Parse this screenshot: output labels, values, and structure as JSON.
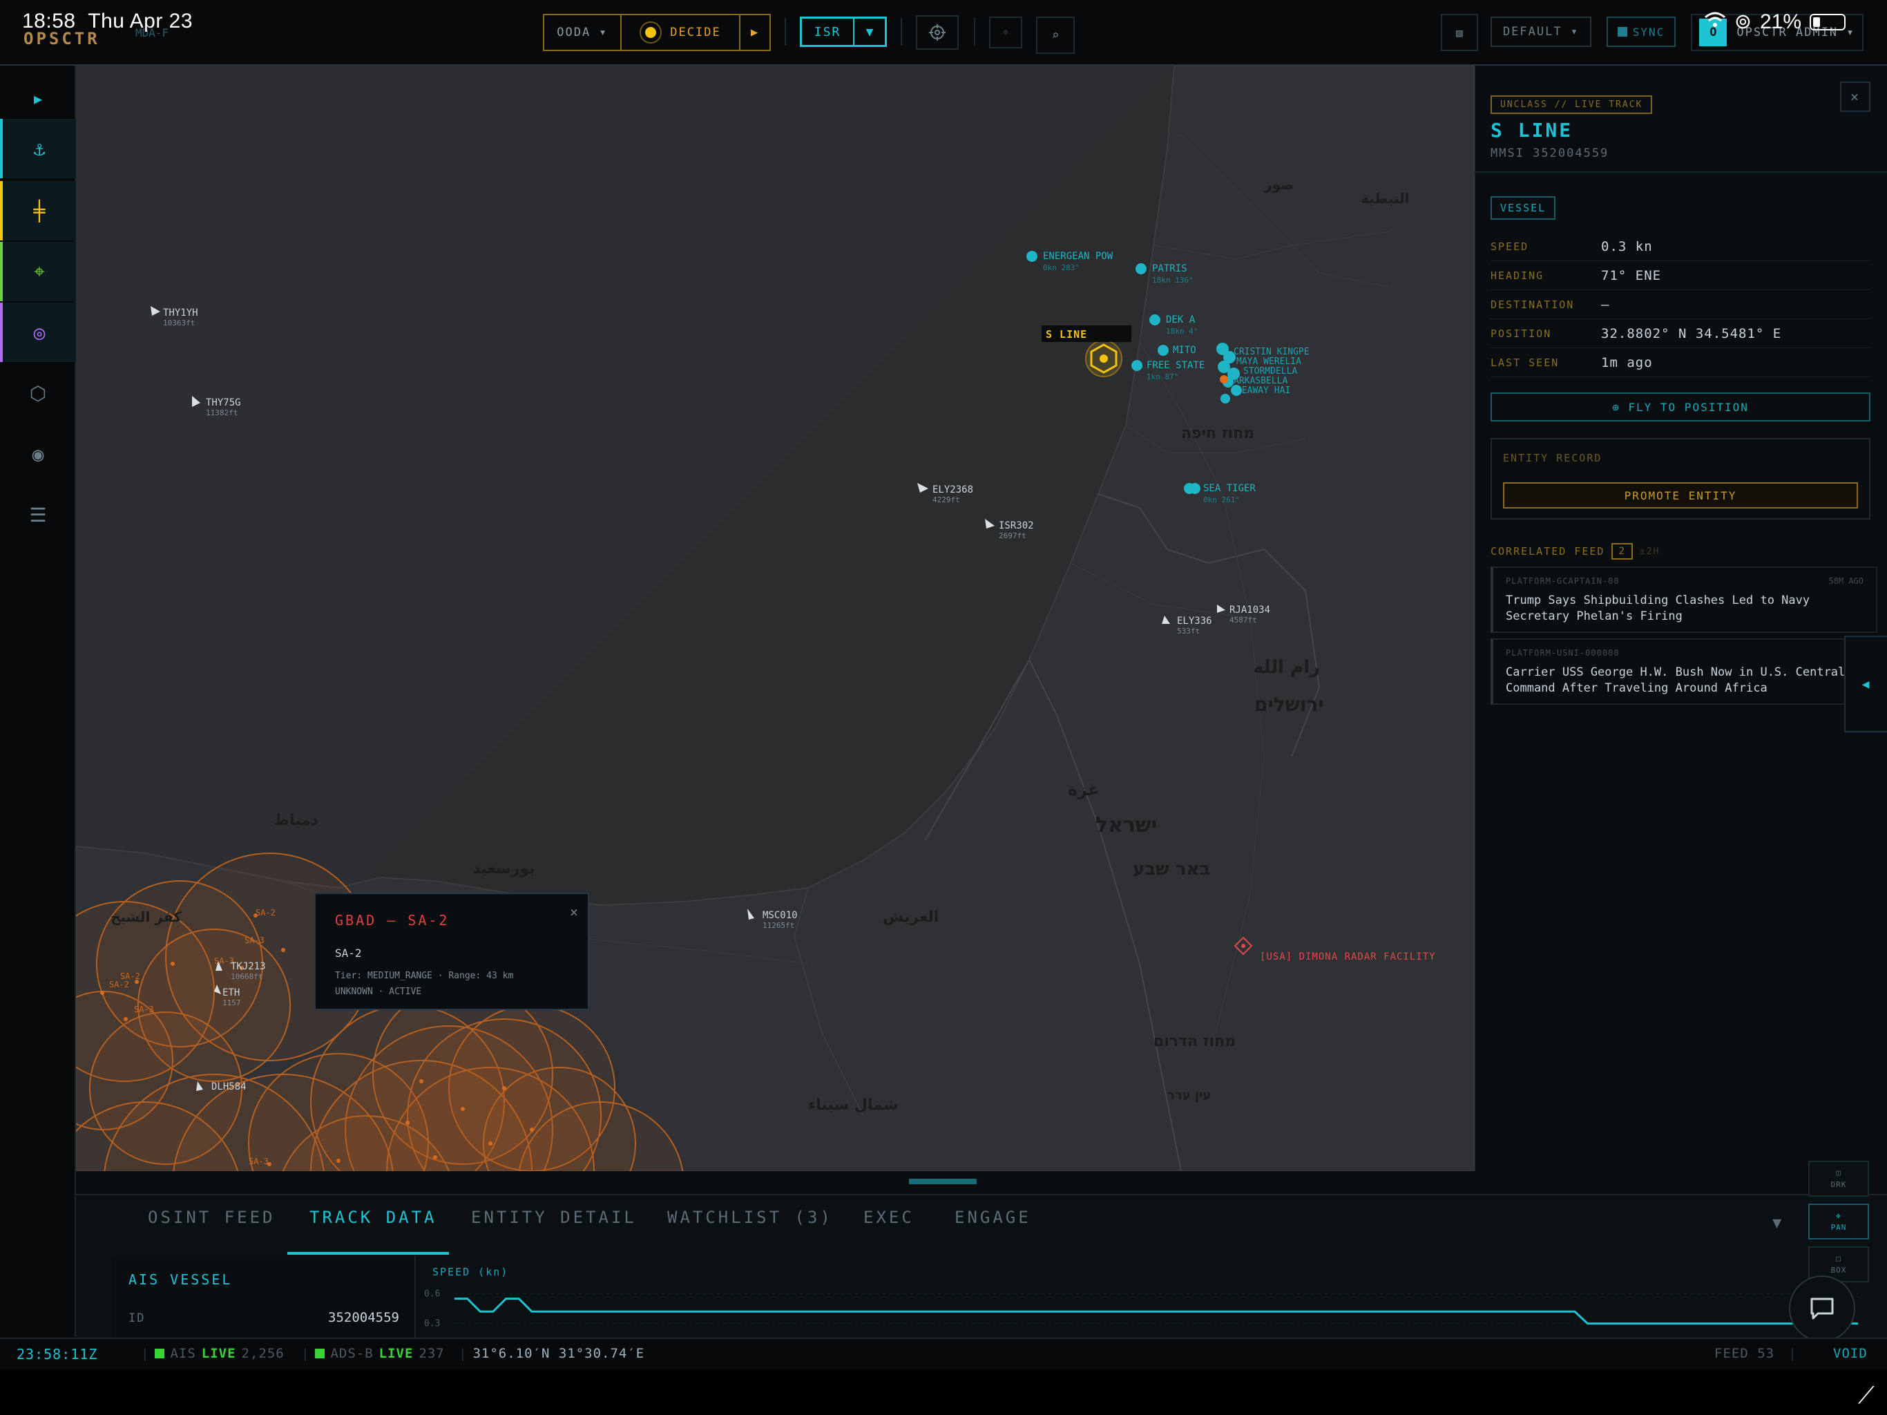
{
  "status_bar": {
    "time": "18:58",
    "date": "Thu Apr 23",
    "battery": "21%"
  },
  "app": {
    "logo": "OPSCTR",
    "logo_sub": "MDA-F"
  },
  "toolbar": {
    "ooda_label": "OODA ▾",
    "phase_label": "DECIDE",
    "play_icon": "▶",
    "isr_label": "ISR",
    "isr_caret": "▼",
    "default_label": "DEFAULT ▾",
    "sync_label": "SYNC",
    "user_initial": "O",
    "user_label": "OPSCTR ADMIN ▾"
  },
  "rail": {
    "expand_icon": "▶",
    "items": [
      {
        "icon": "anchor-icon",
        "color": "#1ec4d4",
        "glyph": "⚓"
      },
      {
        "icon": "aircraft-icon",
        "color": "#f2c40f",
        "glyph": "╪"
      },
      {
        "icon": "crosshair-icon",
        "color": "#6fcf3a",
        "glyph": "⌖"
      },
      {
        "icon": "orbit-icon",
        "color": "#b16cf2",
        "glyph": "◎"
      },
      {
        "icon": "alert-shield-icon",
        "color": "#6b7f8a",
        "glyph": "⬡"
      },
      {
        "icon": "eye-icon",
        "color": "#6b7f8a",
        "glyph": "◉"
      },
      {
        "icon": "database-icon",
        "color": "#6b7f8a",
        "glyph": "☰"
      }
    ]
  },
  "map": {
    "selected_label": "S LINE",
    "vessels": [
      {
        "name": "ENERGEAN POW",
        "sub": "0kn 283°"
      },
      {
        "name": "PATRIS",
        "sub": "18kn 136°"
      },
      {
        "name": "DEK A",
        "sub": "18kn 4°"
      },
      {
        "name": "MITO",
        "sub": ""
      },
      {
        "name": "FREE STATE",
        "sub": "1kn 87°"
      },
      {
        "name": "SEA TIGER",
        "sub": "0kn 261°"
      }
    ],
    "aircraft": [
      {
        "name": "THY1YH",
        "sub": "10363ft"
      },
      {
        "name": "THY75G",
        "sub": "11382ft"
      },
      {
        "name": "ELY2368",
        "sub": "4229ft"
      },
      {
        "name": "ISR302",
        "sub": "2697ft"
      },
      {
        "name": "ELY336",
        "sub": "533ft"
      },
      {
        "name": "RJA1034",
        "sub": "4587ft"
      },
      {
        "name": "MSC010",
        "sub": "11265ft"
      },
      {
        "name": "TKJ213",
        "sub": "10668ft"
      },
      {
        "name": "ETH",
        "sub": "1157"
      },
      {
        "name": "DLH584",
        "sub": ""
      }
    ],
    "facility": "[USA] DIMONA RADAR FACILITY",
    "place_labels": [
      "غزة",
      "ישראל",
      "באר שבע",
      "رام الله",
      "ירושלים",
      "מחוז הדרום",
      "شمال سيناء",
      "العريش",
      "بورسعيد",
      "دمياط",
      "كفر الشيخ",
      "صور",
      "النبطية",
      "מחוז חיפה",
      "עין ערר"
    ]
  },
  "popup": {
    "title": "GBAD — SA-2",
    "name": "SA-2",
    "detail1": "Tier: MEDIUM_RANGE · Range: 43 km",
    "detail2": "UNKNOWN · ACTIVE",
    "close": "×"
  },
  "panel": {
    "classification": "UNCLASS // LIVE TRACK",
    "name": "S LINE",
    "mmsi": "MMSI 352004559",
    "type": "VESSEL",
    "fields": [
      {
        "key": "SPEED",
        "value": "0.3 kn"
      },
      {
        "key": "HEADING",
        "value": "71° ENE"
      },
      {
        "key": "DESTINATION",
        "value": "—"
      },
      {
        "key": "POSITION",
        "value": "32.8802° N 34.5481° E"
      },
      {
        "key": "LAST SEEN",
        "value": "1m ago"
      }
    ],
    "fly_label": "⊕ FLY TO POSITION",
    "entity_label": "ENTITY RECORD",
    "promote_label": "PROMOTE ENTITY",
    "feed_label": "CORRELATED FEED",
    "feed_count": "2",
    "feed_time": "±2H",
    "feed": [
      {
        "source": "PLATFORM-GCAPTAIN-00",
        "ago": "58M AGO",
        "text": "Trump Says Shipbuilding Clashes Led to Navy Secretary Phelan's Firing"
      },
      {
        "source": "PLATFORM-USNI-000000",
        "ago": "1H A",
        "text": "Carrier USS George H.W. Bush Now in U.S. Central Command After Traveling Around Africa"
      }
    ],
    "close": "×",
    "collapse": "◀"
  },
  "bottom": {
    "tabs": [
      "OSINT FEED",
      "TRACK DATA",
      "ENTITY DETAIL",
      "WATCHLIST (3)",
      "EXEC",
      "ENGAGE"
    ],
    "active_tab": "TRACK DATA",
    "caret": "▼",
    "ais_title": "AIS VESSEL",
    "ais_id_key": "ID",
    "ais_id_val": "352004559",
    "speed_label": "SPEED (kn)",
    "speed_ticks": [
      "0.6",
      "0.3"
    ],
    "tools": [
      {
        "label": "DRK",
        "glyph": "◫"
      },
      {
        "label": "PAN",
        "glyph": "✥"
      },
      {
        "label": "BOX",
        "glyph": "□"
      }
    ]
  },
  "chart_data": {
    "type": "line",
    "title": "",
    "ylabel": "SPEED (kn)",
    "ylim": [
      0.2,
      0.7
    ],
    "series": [
      {
        "values": [
          0.55,
          0.55,
          0.42,
          0.42,
          0.55,
          0.55,
          0.42,
          0.42,
          0.42,
          0.42,
          0.42,
          0.42,
          0.42,
          0.42,
          0.42,
          0.42,
          0.42,
          0.42,
          0.42,
          0.42,
          0.42,
          0.42,
          0.42,
          0.42,
          0.42,
          0.42,
          0.42,
          0.42,
          0.42,
          0.42,
          0.42,
          0.42,
          0.42,
          0.42,
          0.42,
          0.42,
          0.42,
          0.42,
          0.42,
          0.42,
          0.42,
          0.42,
          0.42,
          0.42,
          0.42,
          0.42,
          0.42,
          0.42,
          0.42,
          0.42,
          0.42,
          0.42,
          0.42,
          0.42,
          0.42,
          0.42,
          0.42,
          0.42,
          0.42,
          0.42,
          0.42,
          0.42,
          0.42,
          0.42,
          0.42,
          0.42,
          0.42,
          0.42,
          0.42,
          0.42,
          0.42,
          0.42,
          0.42,
          0.42,
          0.42,
          0.42,
          0.42,
          0.42,
          0.42,
          0.42,
          0.42,
          0.42,
          0.42,
          0.42,
          0.42,
          0.42,
          0.42,
          0.42,
          0.3,
          0.3,
          0.3,
          0.3,
          0.3,
          0.3,
          0.3,
          0.3,
          0.3,
          0.3,
          0.3,
          0.3,
          0.3,
          0.3,
          0.3,
          0.3,
          0.3,
          0.3,
          0.3,
          0.3,
          0.3,
          0.3
        ]
      }
    ]
  },
  "footer": {
    "clock": "23:58:11Z",
    "ais_label": "AIS",
    "ais_status": "LIVE",
    "ais_count": "2,256",
    "adsb_label": "ADS-B",
    "adsb_status": "LIVE",
    "adsb_count": "237",
    "coords": "31°6.10′N 31°30.74′E",
    "feed": "FEED 53",
    "void": "VOID"
  },
  "colors": {
    "accent": "#1ec4d4",
    "amber": "#e8a32a",
    "threat": "#e0701e",
    "alert": "#e04040",
    "live": "#38d43a"
  }
}
